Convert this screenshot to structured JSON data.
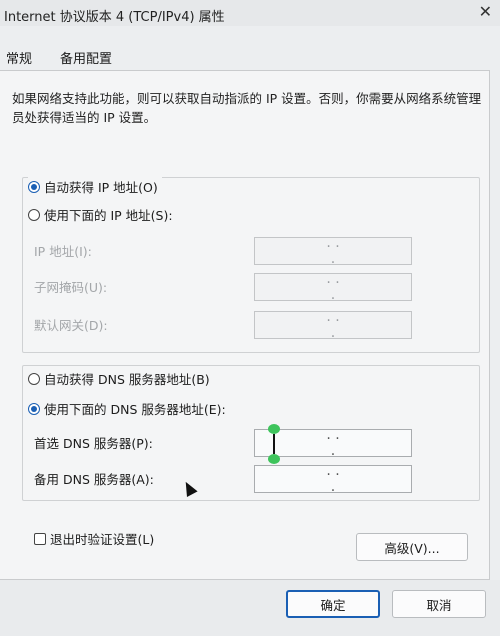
{
  "window": {
    "title": "Internet 协议版本 4 (TCP/IPv4) 属性"
  },
  "tabs": [
    {
      "label": "常规"
    },
    {
      "label": "备用配置"
    }
  ],
  "description": "如果网络支持此功能，则可以获取自动指派的 IP 设置。否则，你需要从网络系统管理员处获得适当的 IP 设置。",
  "ip": {
    "auto_label": "自动获得 IP 地址(O)",
    "manual_label": "使用下面的 IP 地址(S):",
    "selected": "auto",
    "fields": [
      {
        "label": "IP 地址(I):",
        "value": ". . ."
      },
      {
        "label": "子网掩码(U):",
        "value": ". . ."
      },
      {
        "label": "默认网关(D):",
        "value": ". . ."
      }
    ]
  },
  "dns": {
    "auto_label": "自动获得 DNS 服务器地址(B)",
    "manual_label": "使用下面的 DNS 服务器地址(E):",
    "selected": "manual",
    "fields": [
      {
        "label": "首选 DNS 服务器(P):",
        "value": ". . ."
      },
      {
        "label": "备用 DNS 服务器(A):",
        "value": ". . ."
      }
    ]
  },
  "validate_on_exit": {
    "label": "退出时验证设置(L)",
    "checked": false
  },
  "buttons": {
    "advanced": "高级(V)...",
    "ok": "确定",
    "cancel": "取消"
  },
  "colors": {
    "accent": "#1a5fb4",
    "selection_handle": "#3ec45c"
  }
}
